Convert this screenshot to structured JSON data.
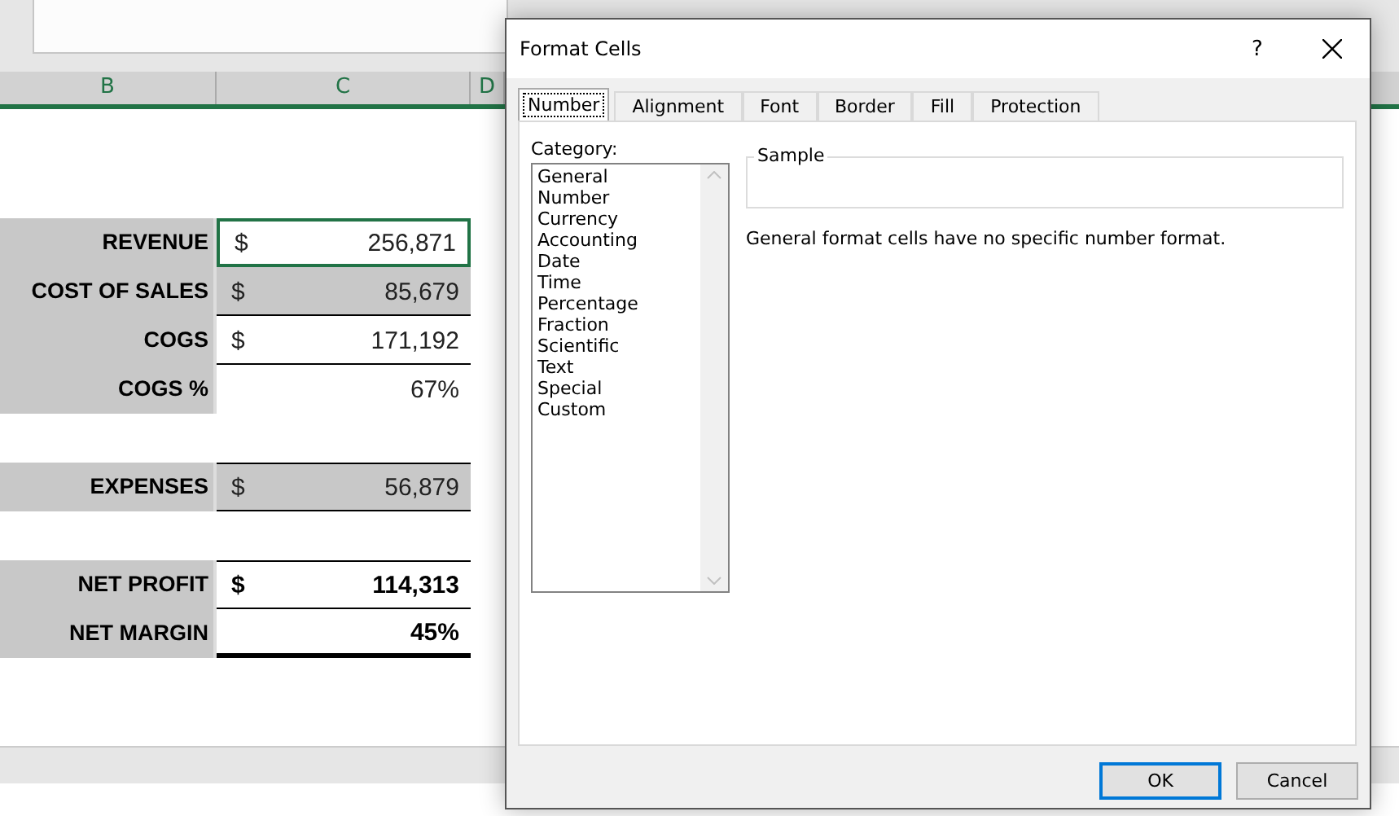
{
  "sheet": {
    "columns": [
      "B",
      "C",
      "D"
    ],
    "rows": [
      {
        "kind": "value",
        "label": "REVENUE",
        "symbol": "$",
        "value": "256,871",
        "bold": false,
        "shaded": false,
        "selected": true,
        "top_border": false,
        "bottom_border": false,
        "thick_border": false
      },
      {
        "kind": "value",
        "label": "COST OF SALES",
        "symbol": "$",
        "value": "85,679",
        "bold": false,
        "shaded": true,
        "selected": false,
        "top_border": false,
        "bottom_border": true,
        "thick_border": false
      },
      {
        "kind": "value",
        "label": "COGS",
        "symbol": "$",
        "value": "171,192",
        "bold": false,
        "shaded": false,
        "selected": false,
        "top_border": false,
        "bottom_border": true,
        "thick_border": false
      },
      {
        "kind": "value",
        "label": "COGS %",
        "value": "67%",
        "bold": false,
        "shaded": false,
        "selected": false,
        "top_border": false,
        "bottom_border": false,
        "thick_border": false
      },
      {
        "kind": "blank"
      },
      {
        "kind": "value",
        "label": "EXPENSES",
        "symbol": "$",
        "value": "56,879",
        "bold": false,
        "shaded": true,
        "selected": false,
        "top_border": true,
        "bottom_border": true,
        "thick_border": false
      },
      {
        "kind": "blank"
      },
      {
        "kind": "value",
        "label": "NET PROFIT",
        "symbol": "$",
        "value": "114,313",
        "bold": true,
        "shaded": false,
        "selected": false,
        "top_border": true,
        "bottom_border": true,
        "thick_border": false
      },
      {
        "kind": "value",
        "label": "NET MARGIN",
        "value": "45%",
        "bold": true,
        "shaded": false,
        "selected": false,
        "top_border": false,
        "bottom_border": false,
        "thick_border": true
      }
    ]
  },
  "dialog": {
    "title": "Format Cells",
    "help": "?",
    "tabs": [
      {
        "label": "Number",
        "selected": true
      },
      {
        "label": "Alignment",
        "selected": false
      },
      {
        "label": "Font",
        "selected": false
      },
      {
        "label": "Border",
        "selected": false
      },
      {
        "label": "Fill",
        "selected": false
      },
      {
        "label": "Protection",
        "selected": false
      }
    ],
    "category_label": "Category:",
    "categories": [
      {
        "label": "General",
        "selected": false
      },
      {
        "label": "Number",
        "selected": false
      },
      {
        "label": "Currency",
        "selected": false
      },
      {
        "label": "Accounting",
        "selected": false
      },
      {
        "label": "Date",
        "selected": false
      },
      {
        "label": "Time",
        "selected": false
      },
      {
        "label": "Percentage",
        "selected": false
      },
      {
        "label": "Fraction",
        "selected": false
      },
      {
        "label": "Scientific",
        "selected": false
      },
      {
        "label": "Text",
        "selected": false
      },
      {
        "label": "Special",
        "selected": false
      },
      {
        "label": "Custom",
        "selected": false
      }
    ],
    "sample_label": "Sample",
    "description": "General format cells have no specific number format.",
    "buttons": [
      {
        "label": "OK",
        "default": true
      },
      {
        "label": "Cancel",
        "default": false
      }
    ]
  }
}
